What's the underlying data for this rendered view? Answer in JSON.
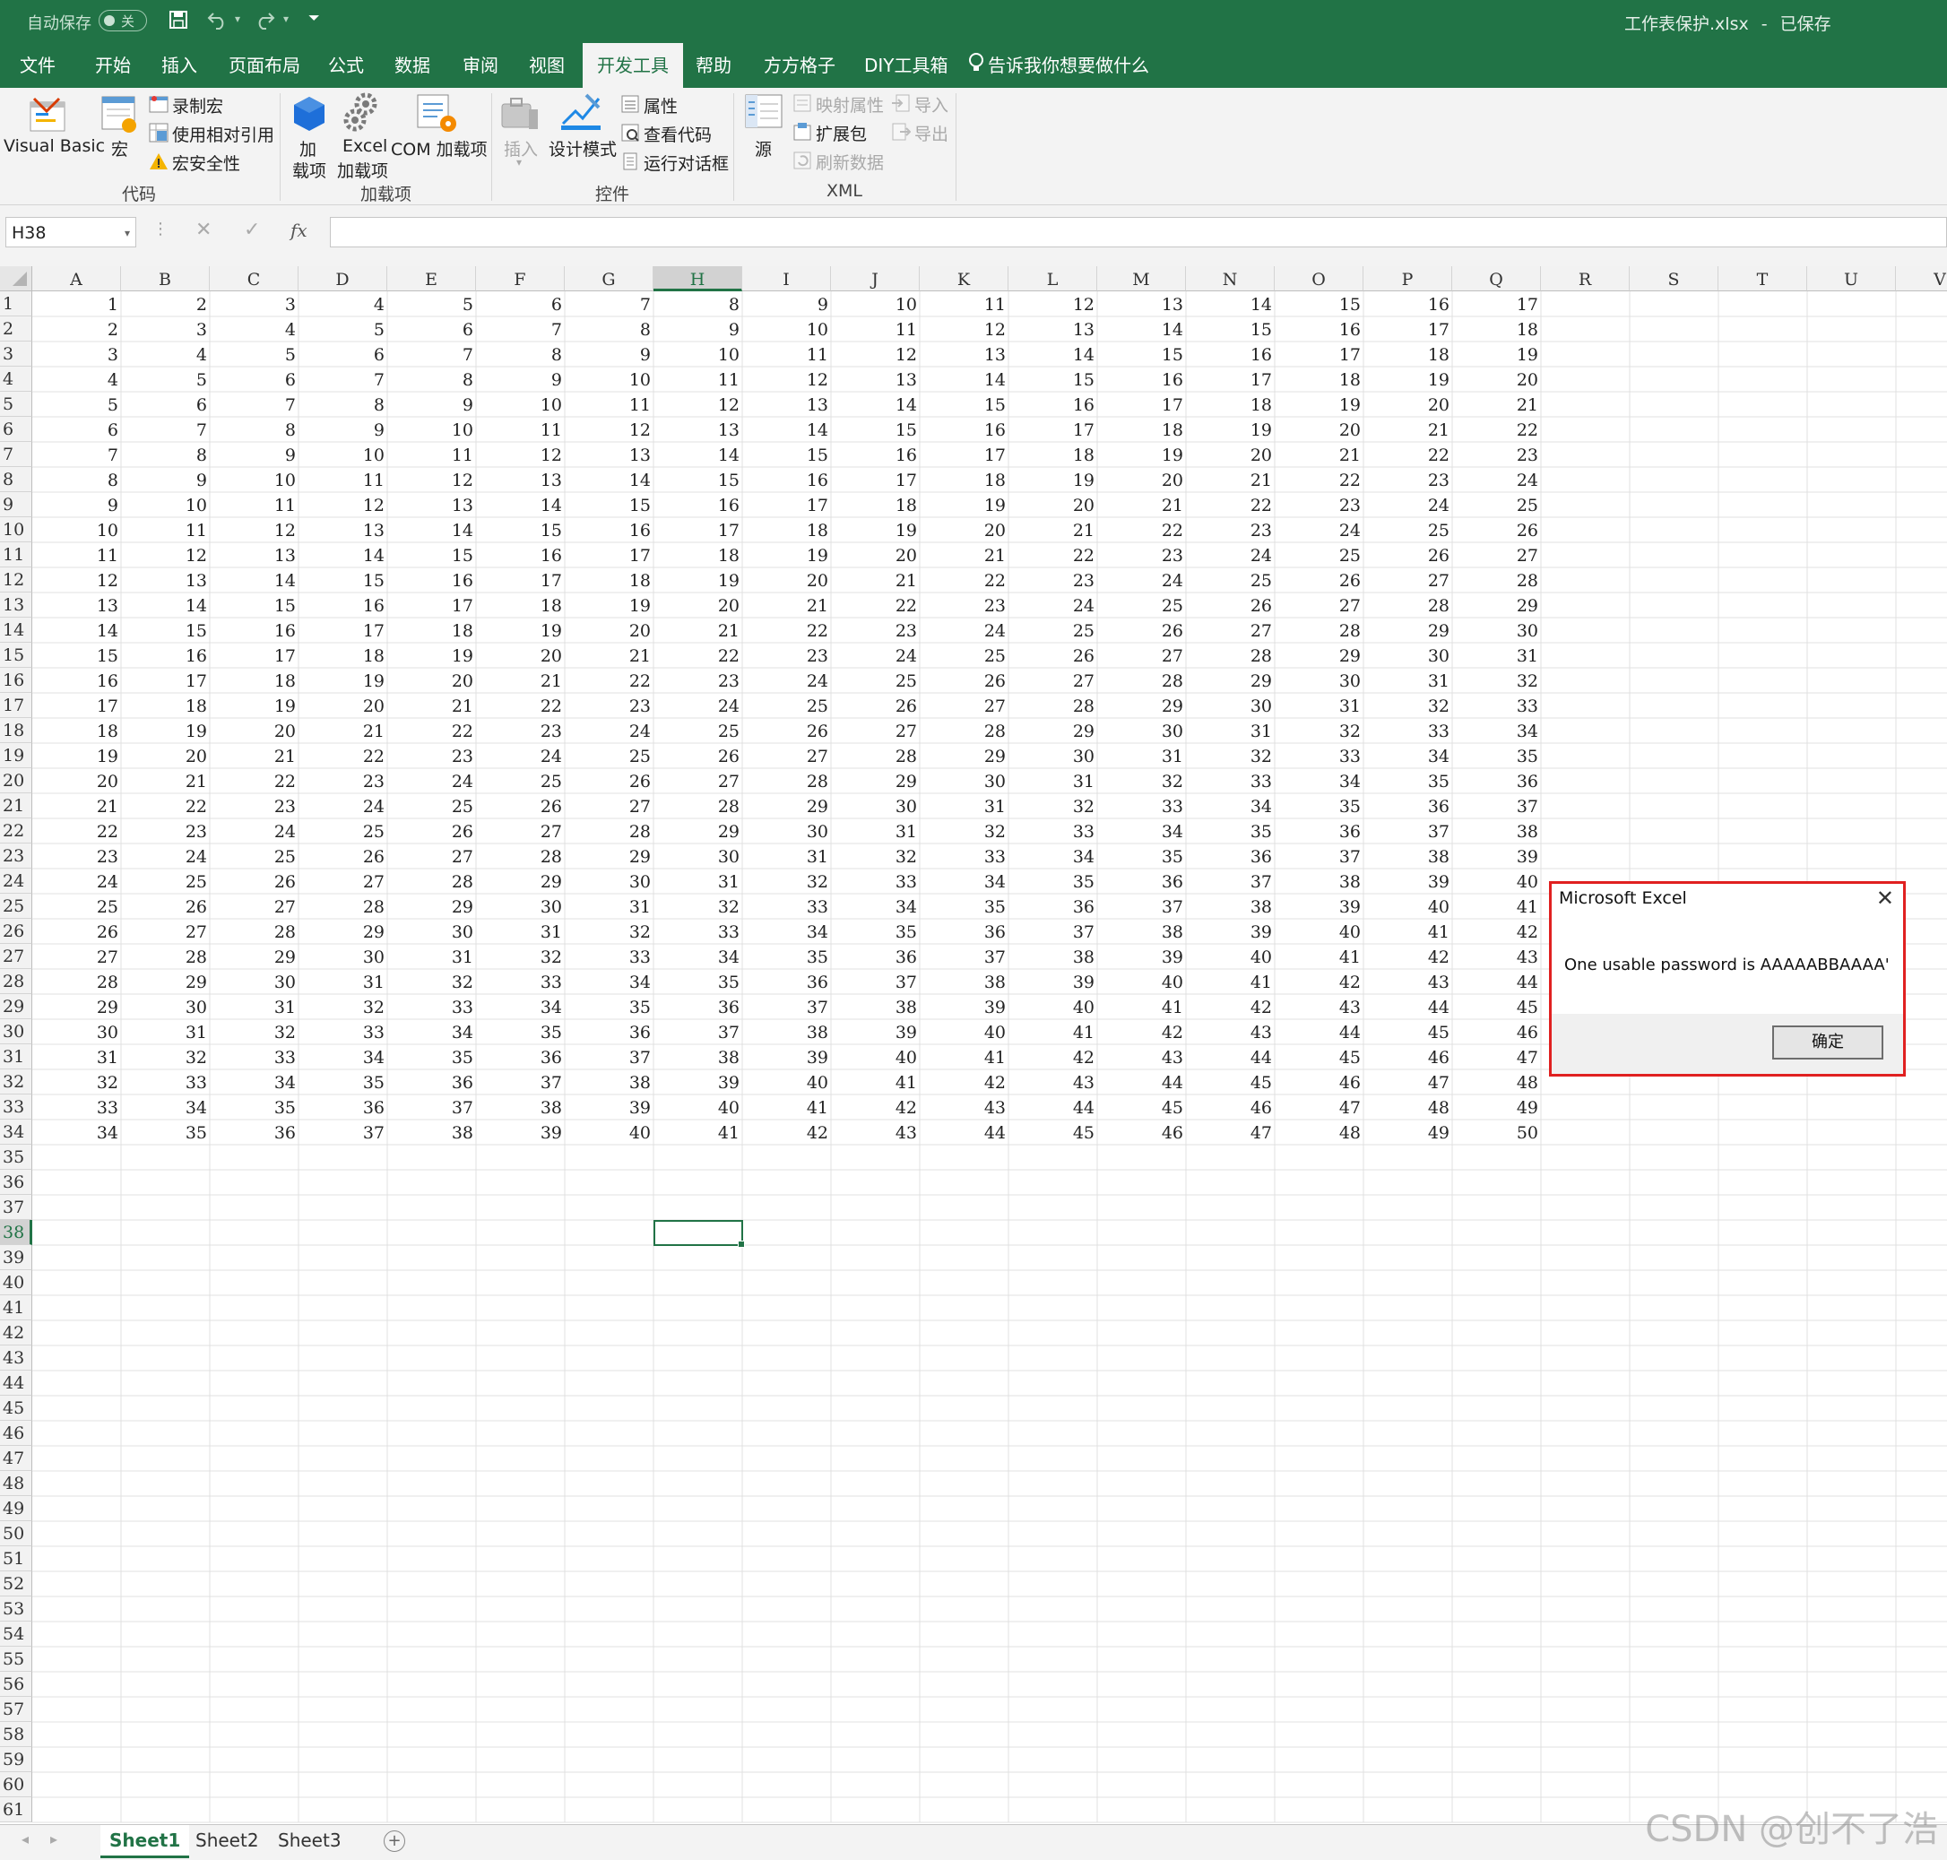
{
  "titlebar": {
    "autosave_label": "自动保存",
    "autosave_state": "关",
    "document_title": "工作表保护.xlsx",
    "separator": "-",
    "save_status": "已保存"
  },
  "tabs": [
    "文件",
    "开始",
    "插入",
    "页面布局",
    "公式",
    "数据",
    "审阅",
    "视图",
    "开发工具",
    "帮助",
    "方方格子",
    "DIY工具箱"
  ],
  "active_tab": "开发工具",
  "tell_me": "告诉我你想要做什么",
  "ribbon": {
    "code": {
      "group_label": "代码",
      "visual_basic": "Visual Basic",
      "macros": "宏",
      "record_macro": "录制宏",
      "relative_ref": "使用相对引用",
      "macro_security": "宏安全性"
    },
    "addins": {
      "group_label": "加载项",
      "addins_line1": "加",
      "addins_line2": "载项",
      "excel_addins_line1": "Excel",
      "excel_addins_line2": "加载项",
      "com_addins": "COM 加载项"
    },
    "controls": {
      "group_label": "控件",
      "insert": "插入",
      "design_mode": "设计模式",
      "properties": "属性",
      "view_code": "查看代码",
      "run_dialog": "运行对话框"
    },
    "xml": {
      "group_label": "XML",
      "source": "源",
      "map_properties": "映射属性",
      "expansion_packs": "扩展包",
      "refresh_data": "刷新数据",
      "import": "导入",
      "export": "导出"
    }
  },
  "formula_bar": {
    "name_box": "H38",
    "fx": "fx",
    "formula": ""
  },
  "grid": {
    "columns": [
      "A",
      "B",
      "C",
      "D",
      "E",
      "F",
      "G",
      "H",
      "I",
      "J",
      "K",
      "L",
      "M",
      "N",
      "O",
      "P",
      "Q",
      "R",
      "S",
      "T",
      "U",
      "V"
    ],
    "selected_cell": "H38",
    "data_columns": 17,
    "data_rows": 34,
    "visible_rows": 61,
    "cell_rule": "value(row, col) = row + col - 1 for rows 1-34, columns A-Q"
  },
  "sheets": [
    "Sheet1",
    "Sheet2",
    "Sheet3"
  ],
  "active_sheet": "Sheet1",
  "dialog": {
    "title": "Microsoft Excel",
    "message": "One usable password is AAAAABBAAAA'",
    "ok_button": "确定"
  },
  "watermark": "CSDN @创不了浩",
  "colors": {
    "excel_green": "#217346",
    "dialog_border": "#e02020"
  }
}
